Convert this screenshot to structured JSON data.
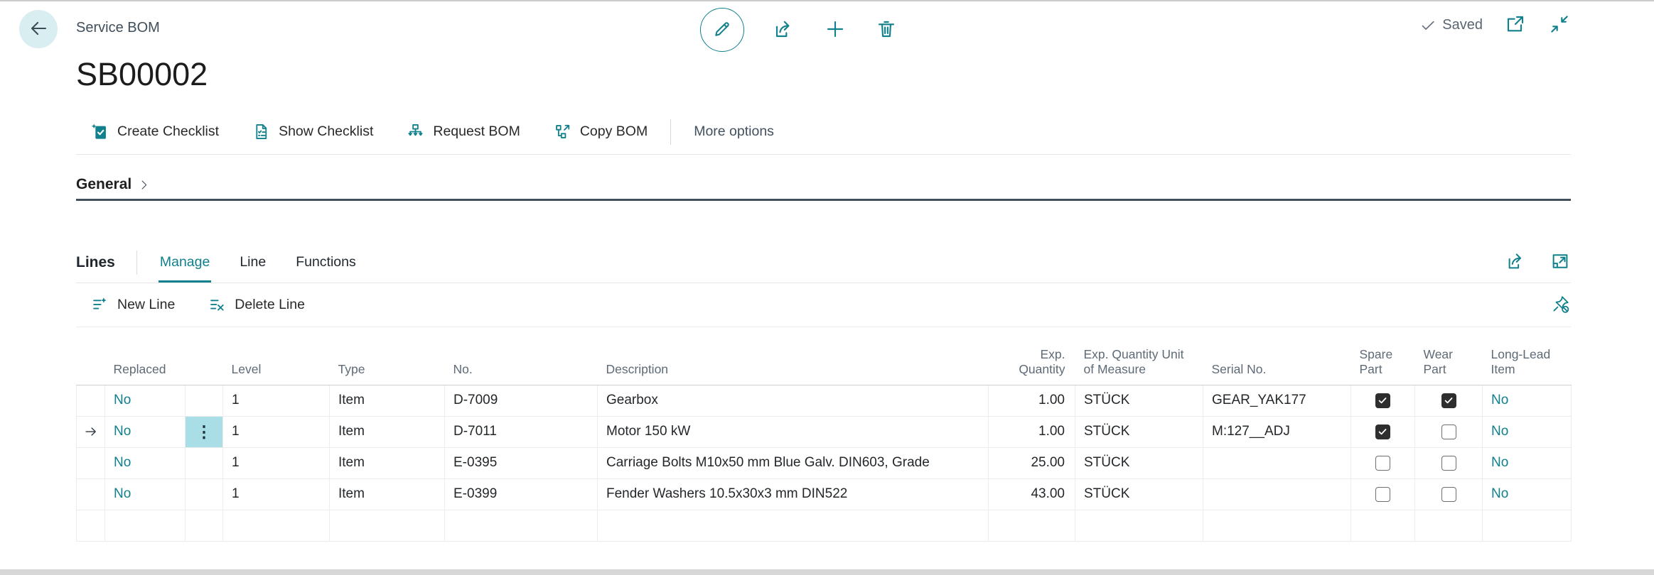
{
  "header": {
    "page_caption": "Service BOM",
    "title": "SB00002",
    "saved_label": "Saved"
  },
  "top_actions": [
    {
      "name": "edit",
      "icon": "pencil-icon"
    },
    {
      "name": "share",
      "icon": "share-icon"
    },
    {
      "name": "new",
      "icon": "plus-icon"
    },
    {
      "name": "delete",
      "icon": "trash-icon"
    }
  ],
  "action_bar": {
    "items": [
      {
        "name": "create-checklist",
        "label": "Create Checklist",
        "icon": "clipboard-check-icon"
      },
      {
        "name": "show-checklist",
        "label": "Show Checklist",
        "icon": "document-check-icon"
      },
      {
        "name": "request-bom",
        "label": "Request BOM",
        "icon": "hierarchy-down-icon"
      },
      {
        "name": "copy-bom",
        "label": "Copy BOM",
        "icon": "hierarchy-copy-icon"
      }
    ],
    "more_options_label": "More options"
  },
  "general_section": {
    "label": "General"
  },
  "lines_section": {
    "label": "Lines",
    "tabs": [
      {
        "name": "manage",
        "label": "Manage",
        "active": true
      },
      {
        "name": "line",
        "label": "Line",
        "active": false
      },
      {
        "name": "functions",
        "label": "Functions",
        "active": false
      }
    ],
    "toolbar": [
      {
        "name": "new-line",
        "label": "New Line",
        "icon": "new-line-icon"
      },
      {
        "name": "delete-line",
        "label": "Delete Line",
        "icon": "delete-line-icon"
      }
    ],
    "table": {
      "headers": {
        "replaced": "Replaced",
        "level": "Level",
        "type": "Type",
        "no": "No.",
        "description": "Description",
        "exp_quantity": "Exp. Quantity",
        "exp_quantity_uom": "Exp. Quantity Unit of Measure",
        "serial_no": "Serial No.",
        "spare_part": "Spare Part",
        "wear_part": "Wear Part",
        "long_lead_item": "Long-Lead Item"
      },
      "rows": [
        {
          "selected": false,
          "replaced": "No",
          "level": "1",
          "type": "Item",
          "no": "D-7009",
          "description": "Gearbox",
          "exp_quantity": "1.00",
          "exp_quantity_uom": "STÜCK",
          "serial_no": "GEAR_YAK177",
          "spare_part": true,
          "wear_part": true,
          "long_lead_item": "No"
        },
        {
          "selected": true,
          "replaced": "No",
          "level": "1",
          "type": "Item",
          "no": "D-7011",
          "description": "Motor 150 kW",
          "exp_quantity": "1.00",
          "exp_quantity_uom": "STÜCK",
          "serial_no": "M:127__ADJ",
          "spare_part": true,
          "wear_part": false,
          "long_lead_item": "No"
        },
        {
          "selected": false,
          "replaced": "No",
          "level": "1",
          "type": "Item",
          "no": "E-0395",
          "description": "Carriage Bolts M10x50 mm Blue Galv. DIN603, Grade",
          "exp_quantity": "25.00",
          "exp_quantity_uom": "STÜCK",
          "serial_no": "",
          "spare_part": false,
          "wear_part": false,
          "long_lead_item": "No"
        },
        {
          "selected": false,
          "replaced": "No",
          "level": "1",
          "type": "Item",
          "no": "E-0399",
          "description": "Fender Washers 10.5x30x3 mm DIN522",
          "exp_quantity": "43.00",
          "exp_quantity_uom": "STÜCK",
          "serial_no": "",
          "spare_part": false,
          "wear_part": false,
          "long_lead_item": "No"
        }
      ],
      "empty_row": true
    }
  },
  "colors": {
    "accent_teal": "#10808c",
    "selected_cell": "#a9dee7",
    "back_button_bg": "#d9eef0",
    "dark_text": "#252423",
    "muted_text": "#5e6a76",
    "section_underline": "#42505c"
  }
}
